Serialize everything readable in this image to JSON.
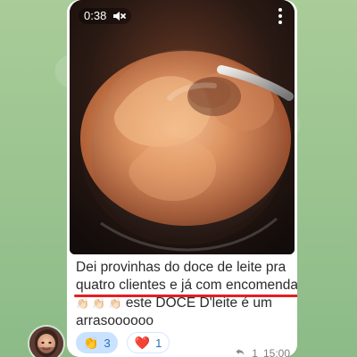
{
  "video": {
    "time": "0:38",
    "mute_icon": "volume-muted-icon",
    "menu_icon": "kebab-menu-icon"
  },
  "message": {
    "line1": "Dei provinhas do doce de leite pra",
    "line2_underlined": "quatro clientes e já com encomendas",
    "line3_emojis": "👏🏻 👏🏻 👏🏻",
    "line3_text": "este DOCE D'leite é um",
    "line4": "arrasoooooo"
  },
  "reactions": [
    {
      "emoji": "👏",
      "count": "3",
      "icon": "clapping-hands-icon"
    },
    {
      "emoji": "❤️",
      "count": "1",
      "icon": "heart-icon"
    }
  ],
  "meta": {
    "reply_count": "1",
    "time": "15:00",
    "reply_icon": "reply-icon"
  }
}
